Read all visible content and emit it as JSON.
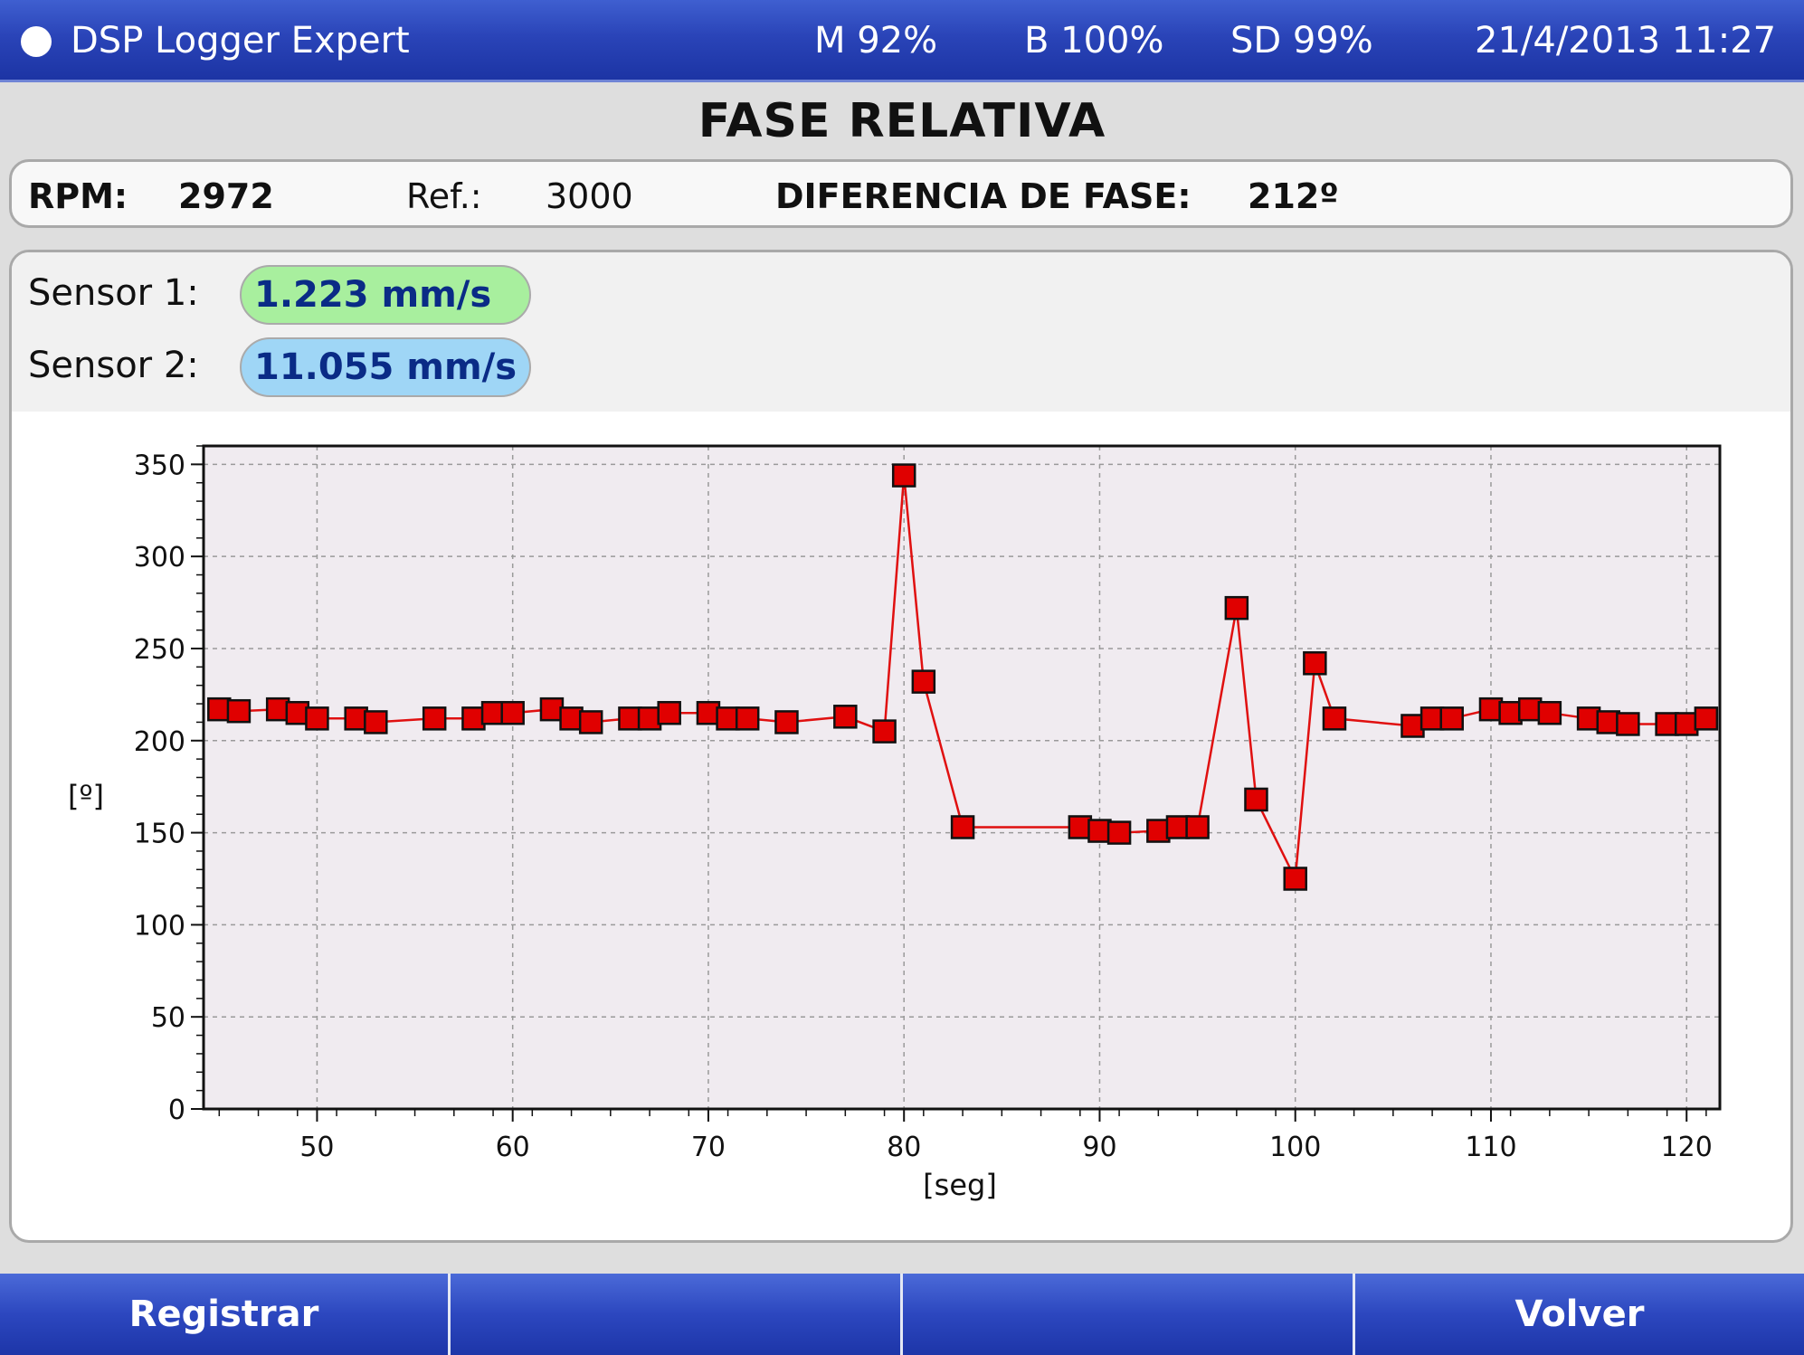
{
  "titlebar": {
    "app_name": "DSP Logger Expert",
    "memory": "M 92%",
    "battery": "B 100%",
    "sd": "SD 99%",
    "datetime": "21/4/2013 11:27"
  },
  "page_title": "FASE RELATIVA",
  "info": {
    "rpm_label": "RPM:",
    "rpm_value": "2972",
    "ref_label": "Ref.:",
    "ref_value": "3000",
    "phase_diff_label": "DIFERENCIA DE FASE:",
    "phase_diff_value": "212º"
  },
  "sensors": [
    {
      "label": "Sensor 1:",
      "value": "1.223 mm/s",
      "color": "#a8ef9e"
    },
    {
      "label": "Sensor 2:",
      "value": "11.055 mm/s",
      "color": "#9fd6f6"
    }
  ],
  "buttons": [
    {
      "label": "Registrar"
    },
    {
      "label": ""
    },
    {
      "label": ""
    },
    {
      "label": "Volver"
    }
  ],
  "chart_data": {
    "type": "line",
    "xlabel": "[seg]",
    "ylabel": "[º]",
    "xlim": [
      44.2,
      121.7
    ],
    "ylim": [
      0,
      360
    ],
    "x_ticks": [
      50,
      60,
      70,
      80,
      90,
      100,
      110,
      120
    ],
    "y_ticks": [
      0,
      50,
      100,
      150,
      200,
      250,
      300,
      350
    ],
    "grid": true,
    "line_color": "#e01010",
    "marker_color": "#e00000",
    "series": [
      {
        "x": [
          45,
          46,
          48,
          49,
          50,
          52,
          53,
          56,
          58,
          59,
          60,
          62,
          63,
          64,
          66,
          67,
          68,
          70,
          71,
          72,
          74,
          77,
          79,
          80,
          81,
          83,
          89,
          90,
          91,
          93,
          94,
          95,
          97,
          98,
          100,
          101,
          102,
          106,
          107,
          108,
          110,
          111,
          112,
          113,
          115,
          116,
          117,
          119,
          120,
          121
        ],
        "y": [
          217,
          216,
          217,
          215,
          212,
          212,
          210,
          212,
          212,
          215,
          215,
          217,
          212,
          210,
          212,
          212,
          215,
          215,
          212,
          212,
          210,
          213,
          205,
          344,
          232,
          153,
          153,
          151,
          150,
          151,
          153,
          153,
          272,
          168,
          125,
          242,
          212,
          208,
          212,
          212,
          217,
          215,
          217,
          215,
          212,
          210,
          209,
          209,
          209,
          212
        ]
      }
    ]
  }
}
